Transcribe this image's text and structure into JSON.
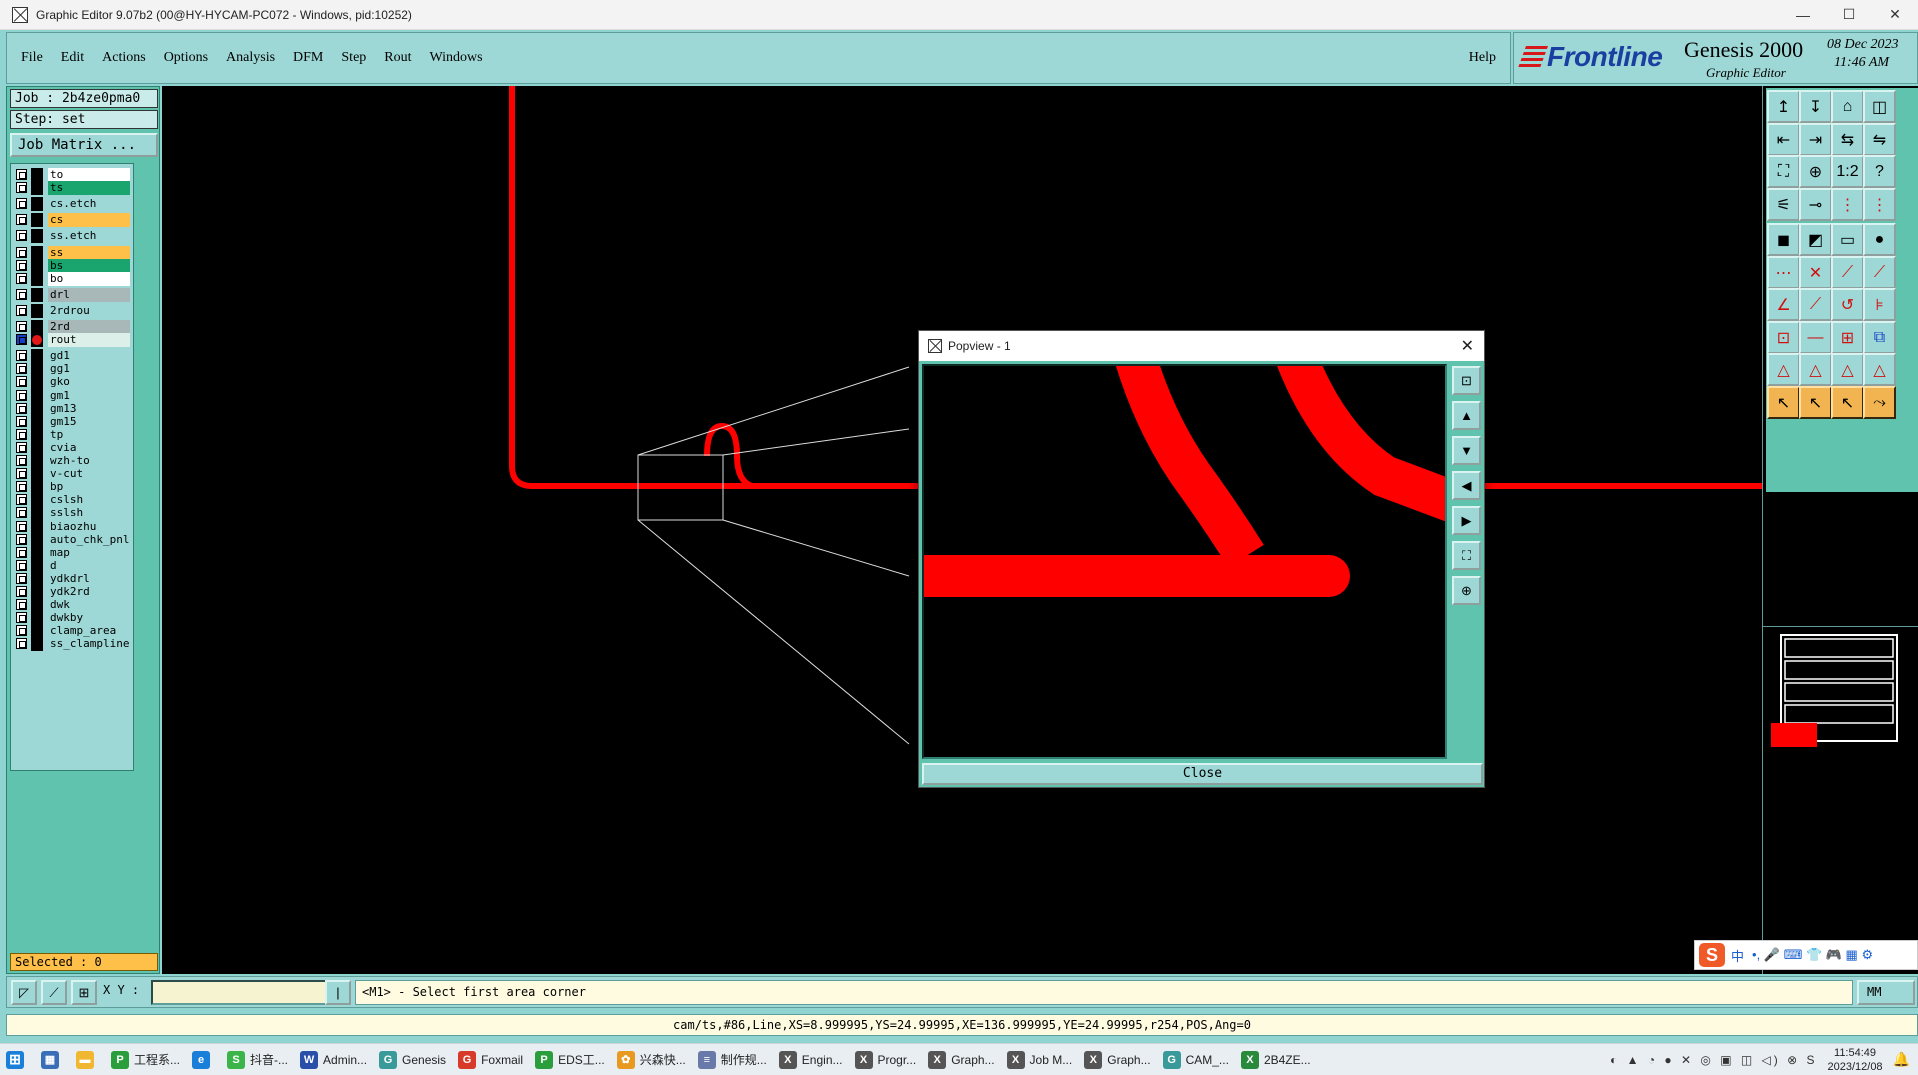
{
  "window": {
    "title": "Graphic Editor 9.07b2 (00@HY-HYCAM-PC072 - Windows, pid:10252)",
    "minimize": "—",
    "maximize": "☐",
    "close": "✕"
  },
  "menu": {
    "items": [
      "File",
      "Edit",
      "Actions",
      "Options",
      "Analysis",
      "DFM",
      "Step",
      "Rout",
      "Windows"
    ],
    "help": "Help"
  },
  "brand": {
    "logo": "Frontline",
    "product": "Genesis 2000",
    "subtitle": "Graphic Editor",
    "date": "08 Dec 2023",
    "time": "11:46 AM"
  },
  "job": {
    "job_label": "Job : 2b4ze0pma0",
    "step_label": "Step: set",
    "matrix_button": "Job Matrix ..."
  },
  "layers": [
    {
      "name": "to",
      "color": "#ffffff"
    },
    {
      "name": "ts",
      "color": "#1aa56e"
    },
    {
      "name": "cs.etch",
      "color": "#9dd8d6"
    },
    {
      "name": "cs",
      "color": "#ffc04a"
    },
    {
      "name": "ss.etch",
      "color": "#9dd8d6"
    },
    {
      "name": "ss",
      "color": "#ffc04a"
    },
    {
      "name": "bs",
      "color": "#1aa56e"
    },
    {
      "name": "bo",
      "color": "#ffffff"
    },
    {
      "name": "drl",
      "color": "#a8b8b8"
    },
    {
      "name": "2rdrou",
      "color": "#9dd8d6"
    },
    {
      "name": "2rd",
      "color": "#a8b8b8"
    },
    {
      "name": "rout",
      "color": "#dcefe9",
      "active": true
    },
    {
      "name": "gd1",
      "color": "#9dd8d6"
    },
    {
      "name": "gg1",
      "color": "#9dd8d6"
    },
    {
      "name": "gko",
      "color": "#9dd8d6"
    },
    {
      "name": "gm1",
      "color": "#9dd8d6"
    },
    {
      "name": "gm13",
      "color": "#9dd8d6"
    },
    {
      "name": "gm15",
      "color": "#9dd8d6"
    },
    {
      "name": "tp",
      "color": "#9dd8d6"
    },
    {
      "name": "cvia",
      "color": "#9dd8d6"
    },
    {
      "name": "wzh-to",
      "color": "#9dd8d6"
    },
    {
      "name": "v-cut",
      "color": "#9dd8d6"
    },
    {
      "name": "bp",
      "color": "#9dd8d6"
    },
    {
      "name": "cslsh",
      "color": "#9dd8d6"
    },
    {
      "name": "sslsh",
      "color": "#9dd8d6"
    },
    {
      "name": "biaozhu",
      "color": "#9dd8d6"
    },
    {
      "name": "auto_chk_pnl",
      "color": "#9dd8d6"
    },
    {
      "name": "map",
      "color": "#9dd8d6"
    },
    {
      "name": "d",
      "color": "#9dd8d6"
    },
    {
      "name": "ydkdrl",
      "color": "#9dd8d6"
    },
    {
      "name": "ydk2rd",
      "color": "#9dd8d6"
    },
    {
      "name": "dwk",
      "color": "#9dd8d6"
    },
    {
      "name": "dwkby",
      "color": "#9dd8d6"
    },
    {
      "name": "clamp_area",
      "color": "#9dd8d6"
    },
    {
      "name": "ss_clampline",
      "color": "#9dd8d6"
    }
  ],
  "selected": "Selected : 0",
  "popview": {
    "title": "Popview - 1",
    "close_icon": "✕",
    "close_button": "Close"
  },
  "command": {
    "xy_label": "X Y :",
    "xy_value": "",
    "prompt": "<M1> - Select first area corner",
    "units": "MM"
  },
  "status": "cam/ts,#86,Line,XS=8.999995,YS=24.99995,XE=136.999995,YE=24.99995,r254,POS,Ang=0",
  "taskbar": {
    "items": [
      {
        "label": "工程系...",
        "icon_color": "#2a9d3c",
        "icon": "P"
      },
      {
        "label": "",
        "icon_color": "#1a7fd8",
        "icon": "e"
      },
      {
        "label": "抖音-...",
        "icon_color": "#3bb54a",
        "icon": "S"
      },
      {
        "label": "Admin...",
        "icon_color": "#2a4fa8",
        "icon": "W"
      },
      {
        "label": "Genesis",
        "icon_color": "#3a9a9a",
        "icon": "G"
      },
      {
        "label": "Foxmail",
        "icon_color": "#d83a2a",
        "icon": "G"
      },
      {
        "label": "EDS工...",
        "icon_color": "#2a9d3c",
        "icon": "P"
      },
      {
        "label": "兴森快...",
        "icon_color": "#e89a20",
        "icon": "✿"
      },
      {
        "label": "制作规...",
        "icon_color": "#6a7aa8",
        "icon": "≡"
      },
      {
        "label": "Engin...",
        "icon_color": "#555555",
        "icon": "X"
      },
      {
        "label": "Progr...",
        "icon_color": "#555555",
        "icon": "X"
      },
      {
        "label": "Graph...",
        "icon_color": "#555555",
        "icon": "X"
      },
      {
        "label": "Job M...",
        "icon_color": "#555555",
        "icon": "X"
      },
      {
        "label": "Graph...",
        "icon_color": "#555555",
        "icon": "X"
      },
      {
        "label": "CAM_...",
        "icon_color": "#3a9a9a",
        "icon": "G"
      },
      {
        "label": "2B4ZE...",
        "icon_color": "#2a8a3c",
        "icon": "X"
      }
    ],
    "clock_time": "11:54:49",
    "clock_date": "2023/12/08"
  },
  "ime": {
    "logo": "S",
    "mode": "中",
    "icons": "•, 🎤 ⌨ 👕 🎮 ▦ ⚙"
  }
}
